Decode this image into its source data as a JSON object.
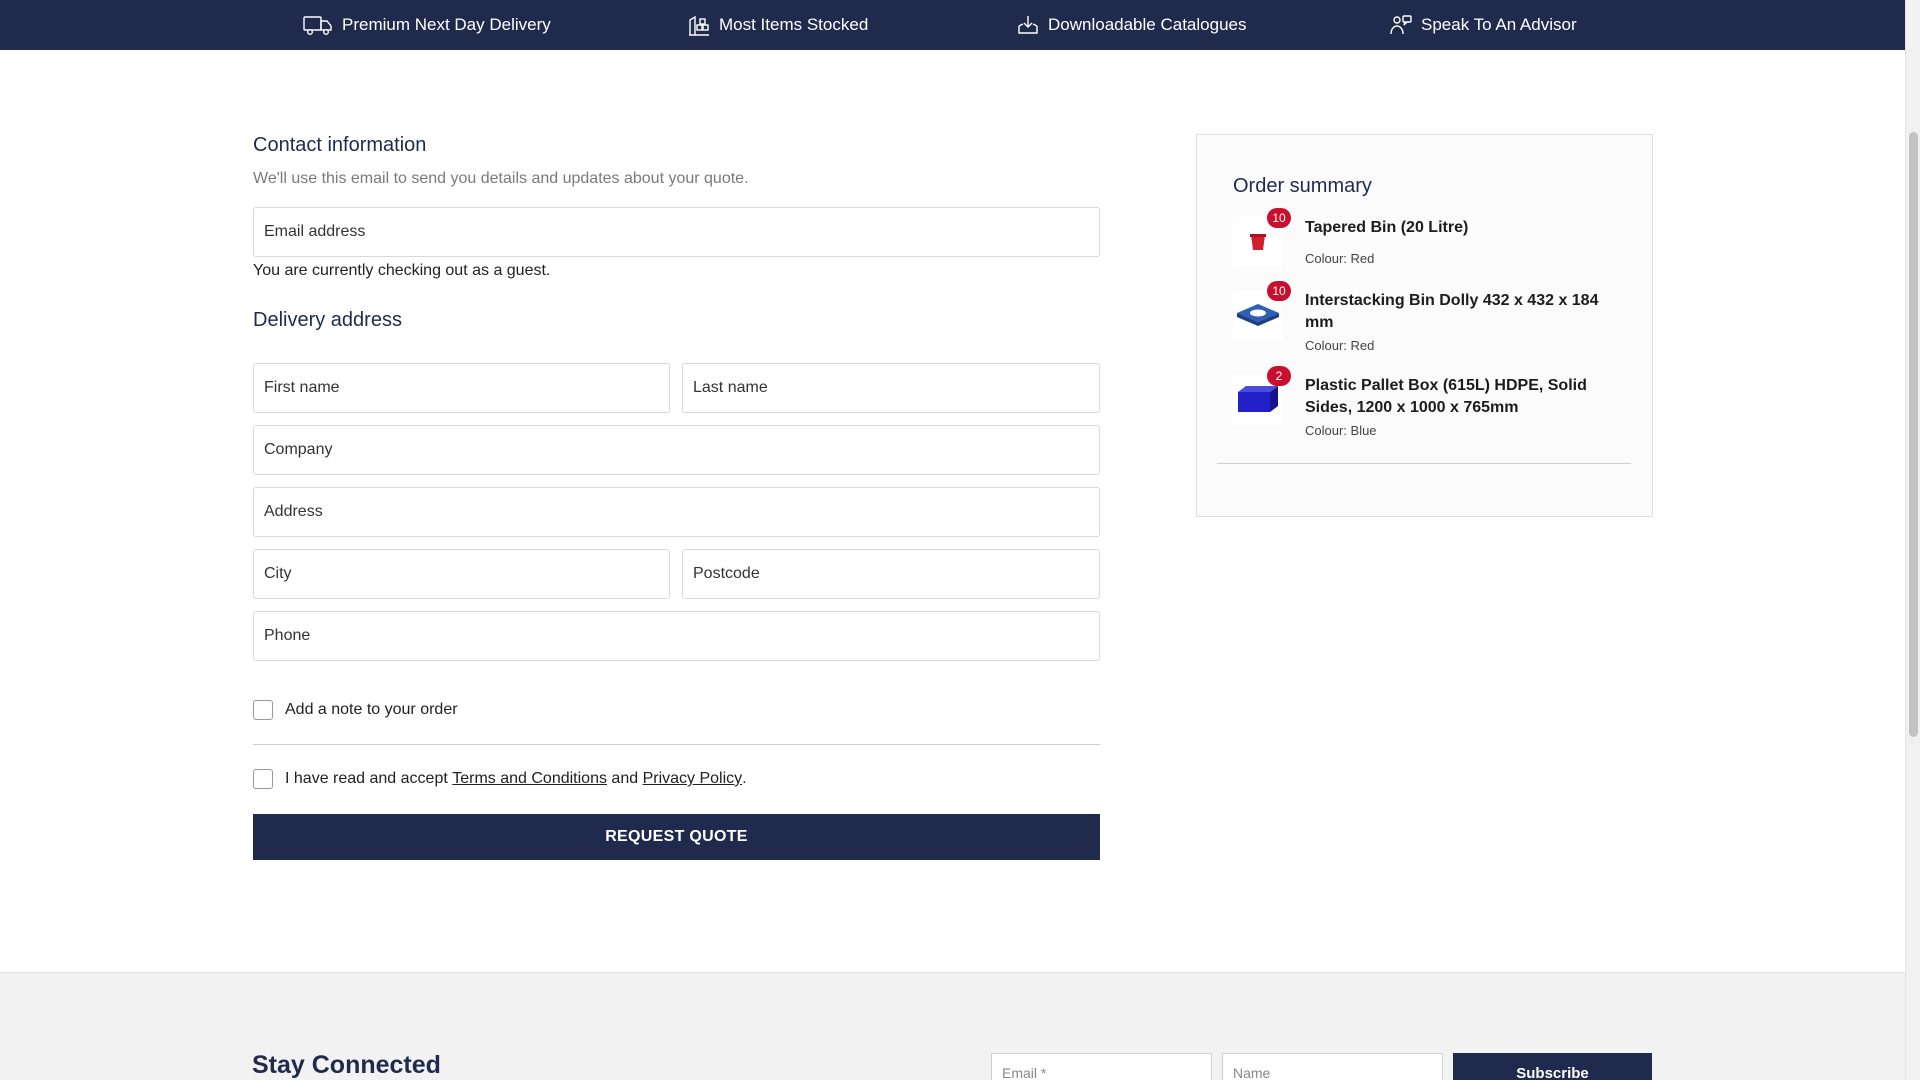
{
  "topbar": {
    "usps": [
      {
        "icon": "delivery-van-icon",
        "label": "Premium Next Day Delivery"
      },
      {
        "icon": "warehouse-shelves-icon",
        "label": "Most Items Stocked"
      },
      {
        "icon": "download-tray-icon",
        "label": "Downloadable Catalogues"
      },
      {
        "icon": "advisor-icon",
        "label": "Speak To An Advisor"
      }
    ]
  },
  "contact": {
    "title": "Contact information",
    "subtitle": "We'll use this email to send you details and updates about your quote.",
    "email_placeholder": "Email address",
    "guest_note": "You are currently checking out as a guest."
  },
  "delivery": {
    "title": "Delivery address",
    "first_name_placeholder": "First name",
    "last_name_placeholder": "Last name",
    "company_placeholder": "Company",
    "address_placeholder": "Address",
    "city_placeholder": "City",
    "postcode_placeholder": "Postcode",
    "phone_placeholder": "Phone"
  },
  "options": {
    "note_label": "Add a note to your order",
    "terms_prefix": "I have read and accept ",
    "terms_link": "Terms and Conditions",
    "terms_middle": " and ",
    "privacy_link": "Privacy Policy",
    "terms_suffix": "."
  },
  "request_button": "REQUEST QUOTE",
  "summary": {
    "title": "Order summary",
    "items": [
      {
        "qty": "10",
        "name": "Tapered Bin (20 Litre)",
        "variant": "Colour: Red",
        "color": "#d0202e"
      },
      {
        "qty": "10",
        "name": "Interstacking Bin Dolly 432 x 432 x 184 mm",
        "variant": "Colour: Red",
        "color": "#2f5fb3"
      },
      {
        "qty": "2",
        "name": "Plastic Pallet Box (615L) HDPE, Solid Sides, 1200 x 1000 x 765mm",
        "variant": "Colour: Blue",
        "color": "#2420c9"
      }
    ]
  },
  "footer": {
    "title": "Stay Connected",
    "email_placeholder": "Email *",
    "name_placeholder": "Name",
    "subscribe": "Subscribe"
  },
  "colors": {
    "brand_navy": "#1f2a4d",
    "badge_red": "#c8102e"
  }
}
